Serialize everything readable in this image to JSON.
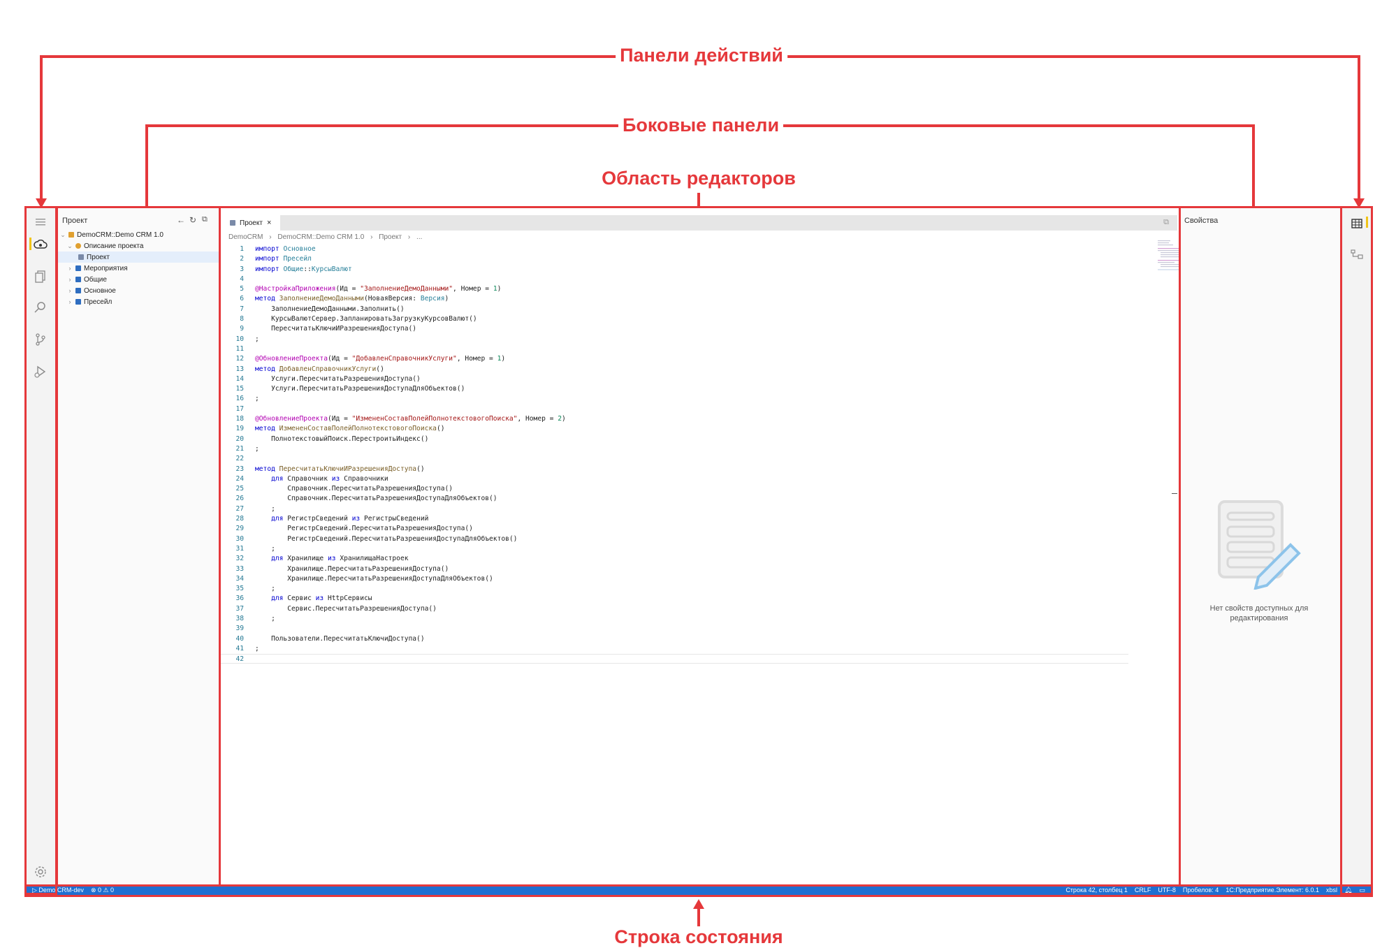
{
  "annotations": {
    "action_panels": "Панели действий",
    "side_panels": "Боковые панели",
    "editor_area": "Область редакторов",
    "status_bar": "Строка состояния"
  },
  "left_panel": {
    "title": "Проект",
    "tree": [
      {
        "label": "DemoCRM::Demo CRM 1.0",
        "level": 0,
        "expanded": true,
        "color": "#e0a030"
      },
      {
        "label": "Описание проекта",
        "level": 1,
        "expanded": true,
        "color": "#e0a030"
      },
      {
        "label": "Проект",
        "level": 2,
        "selected": true,
        "color": "#7a8aa8"
      },
      {
        "label": "Мероприятия",
        "level": 1,
        "expanded": false,
        "color": "#2e6dc0"
      },
      {
        "label": "Общие",
        "level": 1,
        "expanded": false,
        "color": "#2e6dc0"
      },
      {
        "label": "Основное",
        "level": 1,
        "expanded": false,
        "color": "#2e6dc0"
      },
      {
        "label": "Пресейл",
        "level": 1,
        "expanded": false,
        "color": "#2e6dc0"
      }
    ]
  },
  "editor": {
    "tab_label": "Проект",
    "breadcrumbs": [
      "DemoCRM",
      "DemoCRM::Demo CRM 1.0",
      "Проект",
      "..."
    ]
  },
  "code_lines": [
    {
      "n": "1",
      "html": "<span class=\"kw\">импорт</span> <span class=\"ty\">Основное</span>"
    },
    {
      "n": "2",
      "html": "<span class=\"kw\">импорт</span> <span class=\"ty\">Пресейл</span>"
    },
    {
      "n": "3",
      "html": "<span class=\"kw\">импорт</span> <span class=\"ty\">Общие</span>::<span class=\"ty\">КурсыВалют</span>"
    },
    {
      "n": "4",
      "html": ""
    },
    {
      "n": "5",
      "html": "<span class=\"ann\">@НастройкаПриложения</span>(Ид = <span class=\"str\">\"ЗаполнениеДемоДанными\"</span>, Номер = <span class=\"num\">1</span>)"
    },
    {
      "n": "6",
      "html": "<span class=\"kw\">метод</span> <span class=\"fn\">ЗаполнениеДемоДанными</span>(НоваяВерсия: <span class=\"ty\">Версия</span>)"
    },
    {
      "n": "7",
      "html": "    ЗаполнениеДемоДанными.Заполнить()"
    },
    {
      "n": "8",
      "html": "    КурсыВалютСервер.ЗапланироватьЗагрузкуКурсовВалют()"
    },
    {
      "n": "9",
      "html": "    ПересчитатьКлючиИРазрешенияДоступа()"
    },
    {
      "n": "10",
      "html": ";"
    },
    {
      "n": "11",
      "html": ""
    },
    {
      "n": "12",
      "html": "<span class=\"ann\">@ОбновлениеПроекта</span>(Ид = <span class=\"str\">\"ДобавленСправочникУслуги\"</span>, Номер = <span class=\"num\">1</span>)"
    },
    {
      "n": "13",
      "html": "<span class=\"kw\">метод</span> <span class=\"fn\">ДобавленСправочникУслуги</span>()"
    },
    {
      "n": "14",
      "html": "    Услуги.ПересчитатьРазрешенияДоступа()"
    },
    {
      "n": "15",
      "html": "    Услуги.ПересчитатьРазрешенияДоступаДляОбъектов()"
    },
    {
      "n": "16",
      "html": ";"
    },
    {
      "n": "17",
      "html": ""
    },
    {
      "n": "18",
      "html": "<span class=\"ann\">@ОбновлениеПроекта</span>(Ид = <span class=\"str\">\"ИзмененСоставПолейПолнотекстовогоПоиска\"</span>, Номер = <span class=\"num\">2</span>)"
    },
    {
      "n": "19",
      "html": "<span class=\"kw\">метод</span> <span class=\"fn\">ИзмененСоставПолейПолнотекстовогоПоиска</span>()"
    },
    {
      "n": "20",
      "html": "    ПолнотекстовыйПоиск.ПерестроитьИндекс()"
    },
    {
      "n": "21",
      "html": ";"
    },
    {
      "n": "22",
      "html": ""
    },
    {
      "n": "23",
      "html": "<span class=\"kw\">метод</span> <span class=\"fn\">ПересчитатьКлючиИРазрешенияДоступа</span>()"
    },
    {
      "n": "24",
      "html": "    <span class=\"kw\">для</span> Справочник <span class=\"kw\">из</span> Справочники"
    },
    {
      "n": "25",
      "html": "        Справочник.ПересчитатьРазрешенияДоступа()"
    },
    {
      "n": "26",
      "html": "        Справочник.ПересчитатьРазрешенияДоступаДляОбъектов()"
    },
    {
      "n": "27",
      "html": "    ;"
    },
    {
      "n": "28",
      "html": "    <span class=\"kw\">для</span> РегистрСведений <span class=\"kw\">из</span> РегистрыСведений"
    },
    {
      "n": "29",
      "html": "        РегистрСведений.ПересчитатьРазрешенияДоступа()"
    },
    {
      "n": "30",
      "html": "        РегистрСведений.ПересчитатьРазрешенияДоступаДляОбъектов()"
    },
    {
      "n": "31",
      "html": "    ;"
    },
    {
      "n": "32",
      "html": "    <span class=\"kw\">для</span> Хранилище <span class=\"kw\">из</span> ХранилищаНастроек"
    },
    {
      "n": "33",
      "html": "        Хранилище.ПересчитатьРазрешенияДоступа()"
    },
    {
      "n": "34",
      "html": "        Хранилище.ПересчитатьРазрешенияДоступаДляОбъектов()"
    },
    {
      "n": "35",
      "html": "    ;"
    },
    {
      "n": "36",
      "html": "    <span class=\"kw\">для</span> Сервис <span class=\"kw\">из</span> HttpСервисы"
    },
    {
      "n": "37",
      "html": "        Сервис.ПересчитатьРазрешенияДоступа()"
    },
    {
      "n": "38",
      "html": "    ;"
    },
    {
      "n": "39",
      "html": ""
    },
    {
      "n": "40",
      "html": "    Пользователи.ПересчитатьКлючиДоступа()"
    },
    {
      "n": "41",
      "html": ";"
    },
    {
      "n": "42",
      "html": ""
    }
  ],
  "right_panel": {
    "title": "Свойства",
    "empty_message": "Нет свойств доступных для редактирования"
  },
  "status_bar": {
    "left": [
      "Demo CRM-dev",
      "⊗ 0 ⚠ 0"
    ],
    "right": [
      "Строка 42, столбец 1",
      "CRLF",
      "UTF-8",
      "Пробелов: 4",
      "1С:Предприятие.Элемент: 6.0.1",
      "xbsl"
    ]
  },
  "colors": {
    "annotation": "#e5383b",
    "status_bar": "#1f6fd1",
    "accent_marker": "#f0c419"
  }
}
